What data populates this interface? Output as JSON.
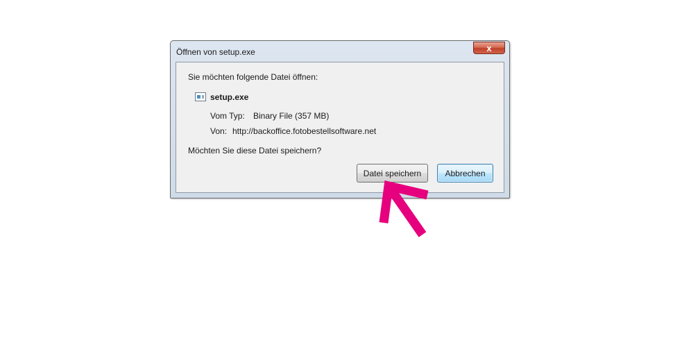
{
  "dialog": {
    "title": "Öffnen von setup.exe",
    "close_label": "x",
    "intro": "Sie möchten folgende Datei öffnen:",
    "file_name": "setup.exe",
    "type_label": "Vom Typ:",
    "type_value": "Binary File (357 MB)",
    "from_label": "Von:",
    "from_value": "http://backoffice.fotobestellsoftware.net",
    "question": "Möchten Sie diese Datei speichern?",
    "buttons": {
      "save": "Datei speichern",
      "cancel": "Abbrechen"
    }
  },
  "annotation": {
    "arrow_color": "#e6007e",
    "arrow_target": "save-button"
  },
  "colors": {
    "dialog_body": "#f0f0f0",
    "close_button": "#c7442c"
  }
}
